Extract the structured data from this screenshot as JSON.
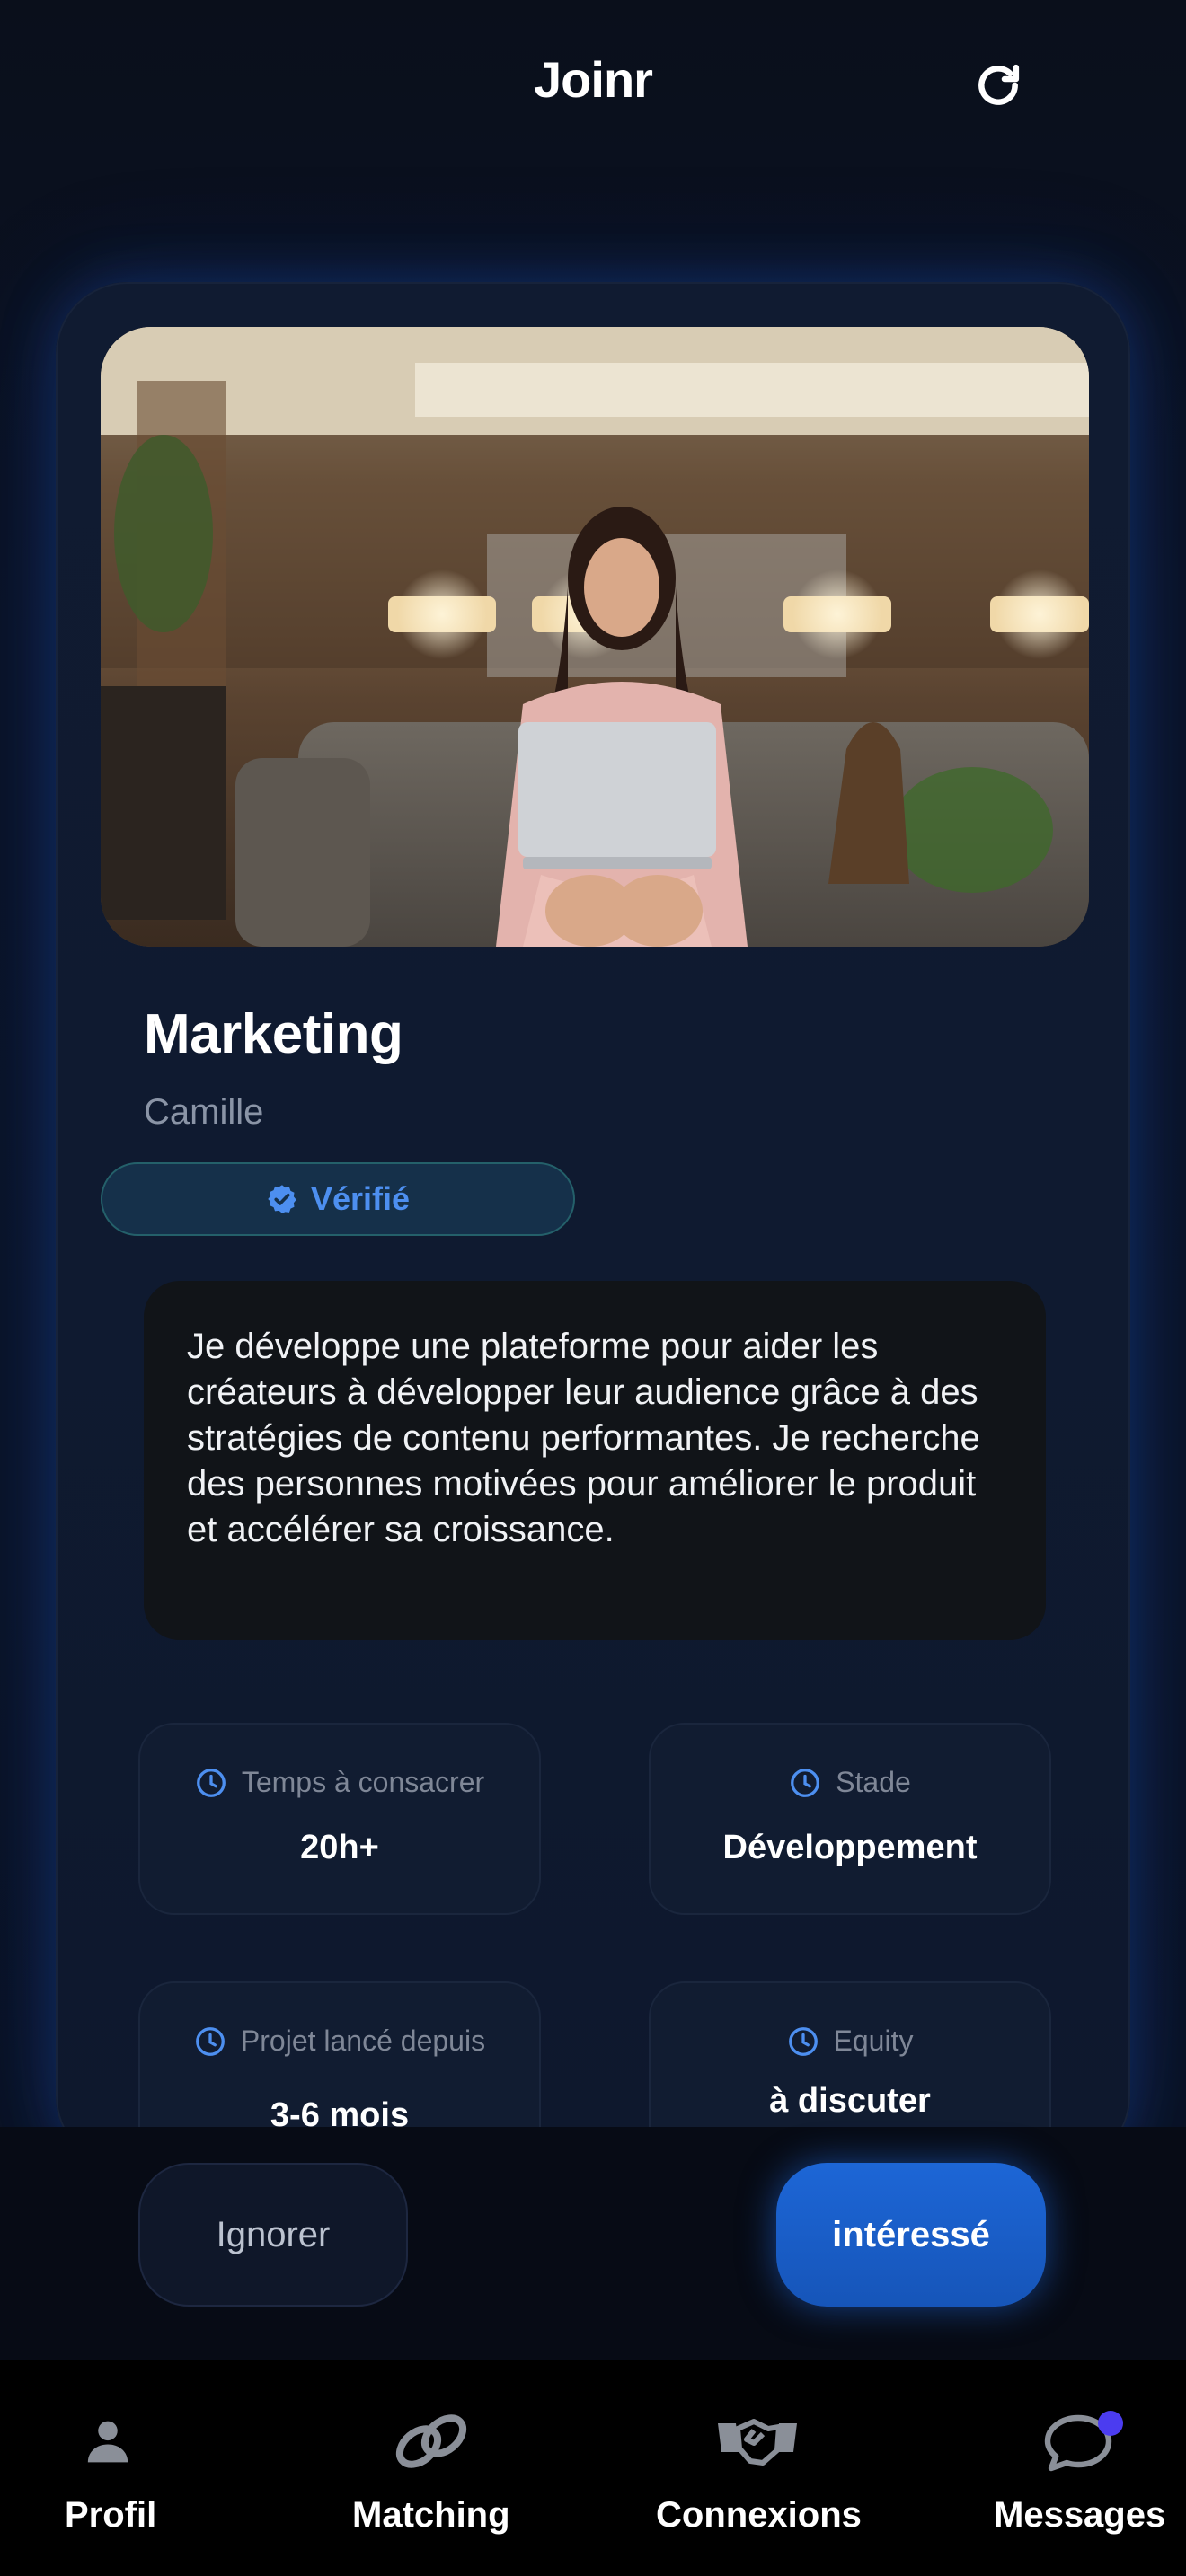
{
  "header": {
    "title": "Joinr",
    "refresh_icon": "refresh-icon"
  },
  "profile": {
    "role": "Marketing",
    "name": "Camille",
    "verified_label": "Vérifié",
    "bio": "Je développe une plateforme pour aider les créateurs à développer leur audience grâce à des stratégies de contenu performantes. Je recherche des personnes motivées pour améliorer le produit et accélérer sa croissance.",
    "stats": [
      {
        "label": "Temps à consacrer",
        "value": "20h+"
      },
      {
        "label": "Stade",
        "value": "Développement"
      },
      {
        "label": "Projet lancé depuis",
        "value": "3-6 mois"
      },
      {
        "label": "Equity",
        "value": "à discuter"
      }
    ]
  },
  "actions": {
    "ignore_label": "Ignorer",
    "interest_label": "intéressé"
  },
  "nav": {
    "items": [
      {
        "label": "Profil",
        "icon": "person-icon"
      },
      {
        "label": "Matching",
        "icon": "link-icon"
      },
      {
        "label": "Connexions",
        "icon": "handshake-icon"
      },
      {
        "label": "Messages",
        "icon": "chat-bubble-icon"
      }
    ]
  },
  "colors": {
    "accent": "#1d66d6",
    "verified": "#4d8ff0",
    "notification": "#4b3cf0",
    "background": "#0b1326"
  }
}
